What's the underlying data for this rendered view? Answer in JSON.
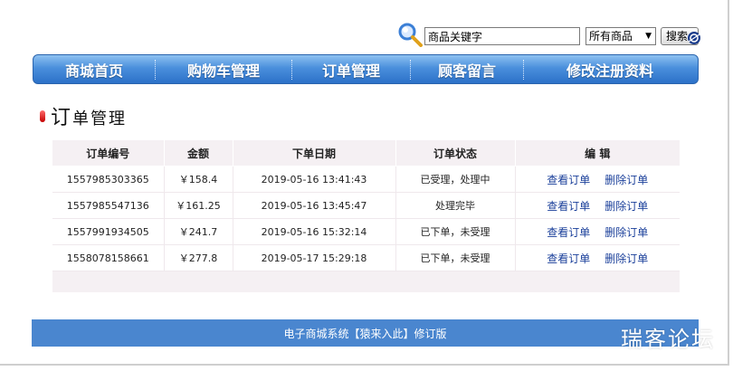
{
  "search": {
    "value": "商品关键字",
    "category": "所有商品",
    "button_label": "搜索"
  },
  "nav": {
    "items": [
      "商城首页",
      "购物车管理",
      "订单管理",
      "顾客留言",
      "修改注册资料"
    ]
  },
  "section": {
    "title_first": "订",
    "title_rest": "单管理"
  },
  "orders": {
    "headers": [
      "订单编号",
      "金额",
      "下单日期",
      "订单状态",
      "编 辑"
    ],
    "rows": [
      {
        "id": "1557985303365",
        "amount": "￥158.4",
        "date": "2019-05-16 13:41:43",
        "status": "已受理，处理中"
      },
      {
        "id": "1557985547136",
        "amount": "￥161.25",
        "date": "2019-05-16 13:45:47",
        "status": "处理完毕"
      },
      {
        "id": "1557991934505",
        "amount": "￥241.7",
        "date": "2019-05-16 15:32:14",
        "status": "已下单，未受理"
      },
      {
        "id": "1558078158661",
        "amount": "￥277.8",
        "date": "2019-05-17 15:29:18",
        "status": "已下单，未受理"
      }
    ],
    "view_label": "查看订单",
    "delete_label": "删除订单"
  },
  "footer": {
    "text": "电子商城系统【猿来入此】修订版"
  },
  "watermark": {
    "text": "瑞客论坛"
  },
  "colors": {
    "nav_blue": "#4a8fdc",
    "footer_blue": "#4a86cf",
    "amount_red": "#e00000",
    "link_blue": "#1a3f9a",
    "header_bg": "#f5f0f3"
  },
  "icons": {
    "search": "magnifier-icon",
    "select_arrow": "triangle-down-icon",
    "title_bullet": "red-pill-icon"
  }
}
